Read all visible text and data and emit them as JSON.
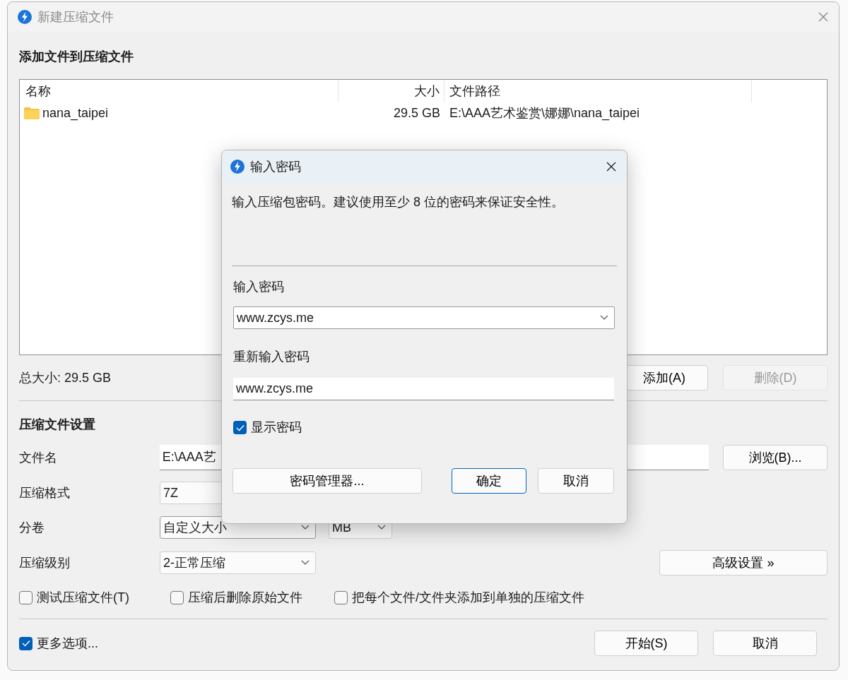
{
  "window": {
    "title": "新建压缩文件"
  },
  "files_section": {
    "heading": "添加文件到压缩文件",
    "columns": [
      "名称",
      "大小",
      "文件路径"
    ],
    "rows": [
      {
        "kind": "folder",
        "name": "nana_taipei",
        "size": "29.5 GB",
        "path": "E:\\AAA艺术鉴赏\\娜娜\\nana_taipei"
      }
    ],
    "total": "总大小: 29.5 GB",
    "buttons": [
      {
        "label": "添加(A)",
        "disabled": false
      },
      {
        "label": "删除(D)",
        "disabled": true
      }
    ]
  },
  "settings": {
    "heading": "压缩文件设置",
    "filename": {
      "label": "文件名",
      "value": "E:\\AAA艺",
      "button": "浏览(B)..."
    },
    "format": {
      "label": "压缩格式",
      "value": "7Z"
    },
    "split": {
      "label": "分卷",
      "value": "自定义大小",
      "unit": "MB"
    },
    "level": {
      "label": "压缩级别",
      "value": "2-正常压缩",
      "button": "高级设置 »"
    },
    "options": [
      {
        "label": "测试压缩文件(T)",
        "checked": false
      },
      {
        "label": "压缩后删除原始文件",
        "checked": false
      },
      {
        "label": "把每个文件/文件夹添加到单独的压缩文件",
        "checked": false
      }
    ]
  },
  "footer": {
    "more_options": {
      "label": "更多选项...",
      "checked": true
    },
    "buttons": [
      "开始(S)",
      "取消"
    ]
  },
  "password_dialog": {
    "title": "输入密码",
    "message": "输入压缩包密码。建议使用至少 8 位的密码来保证安全性。",
    "password_label": "输入密码",
    "password": "www.zcys.me",
    "confirm_label": "重新输入密码",
    "confirm": "www.zcys.me",
    "show_password": {
      "label": "显示密码",
      "checked": true
    },
    "buttons": [
      {
        "label": "密码管理器...",
        "default": false
      },
      {
        "label": "确定",
        "default": true
      },
      {
        "label": "取消",
        "default": false
      }
    ]
  }
}
